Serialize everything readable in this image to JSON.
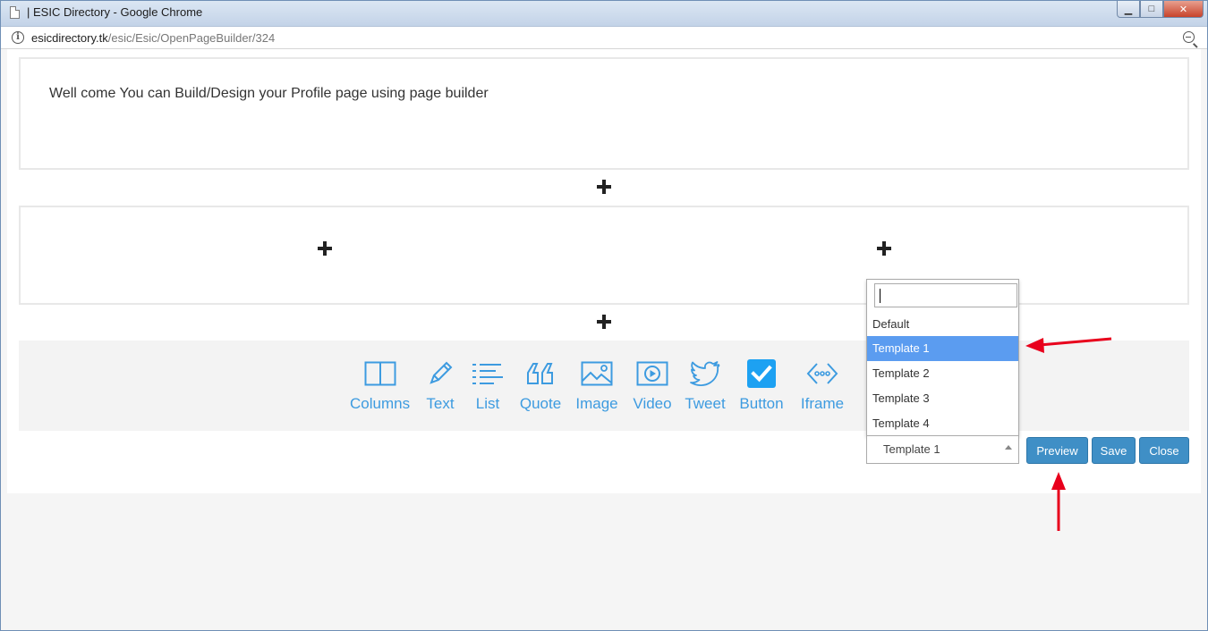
{
  "window": {
    "title": "| ESIC Directory - Google Chrome",
    "min_label": "▁",
    "max_label": "□",
    "close_label": "✕"
  },
  "address": {
    "host": "esicdirectory.tk",
    "path": "/esic/Esic/OpenPageBuilder/324"
  },
  "builder": {
    "welcome_text": "Well come You can Build/Design your Profile page using page builder"
  },
  "toolbar": {
    "items": [
      {
        "label": "Columns",
        "icon": "columns-icon"
      },
      {
        "label": "Text",
        "icon": "pencil-icon"
      },
      {
        "label": "List",
        "icon": "list-icon"
      },
      {
        "label": "Quote",
        "icon": "quote-icon"
      },
      {
        "label": "Image",
        "icon": "image-icon"
      },
      {
        "label": "Video",
        "icon": "video-icon"
      },
      {
        "label": "Tweet",
        "icon": "twitter-icon"
      },
      {
        "label": "Button",
        "icon": "checkbox-icon"
      },
      {
        "label": "Iframe",
        "icon": "iframe-icon"
      }
    ]
  },
  "template_select": {
    "search_value": "",
    "options": [
      "Default",
      "Template 1",
      "Template 2",
      "Template 3",
      "Template 4"
    ],
    "highlighted_index": 1,
    "selected_value": "Template 1"
  },
  "actions": {
    "preview_label": "Preview",
    "save_label": "Save",
    "close_label": "Close"
  },
  "colors": {
    "accent": "#3d9be0",
    "button_bg": "#3f8fc6",
    "highlight": "#5b9cf0",
    "annotation_arrow": "#e8001c"
  }
}
